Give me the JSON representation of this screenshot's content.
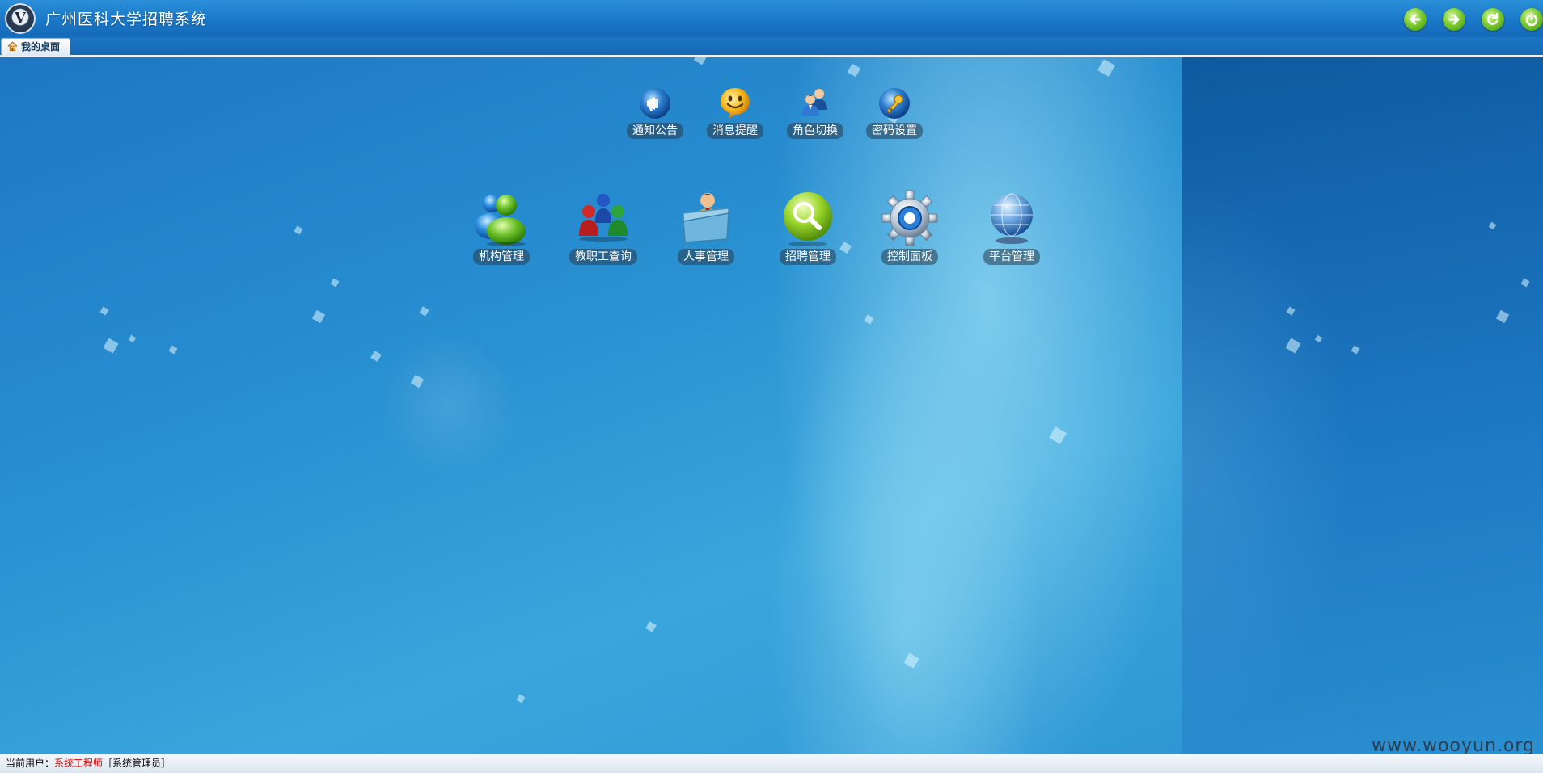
{
  "header": {
    "title": "广州医科大学招聘系统",
    "buttons": [
      {
        "name": "back-button",
        "icon": "arrow-left-icon"
      },
      {
        "name": "forward-button",
        "icon": "arrow-right-icon"
      },
      {
        "name": "refresh-button",
        "icon": "refresh-icon"
      },
      {
        "name": "power-button",
        "icon": "power-icon"
      }
    ]
  },
  "tabs": [
    {
      "label": "我的桌面",
      "icon": "home-icon",
      "active": true
    }
  ],
  "desktop": {
    "top_shortcuts": [
      {
        "label": "通知公告",
        "icon": "megaphone-icon"
      },
      {
        "label": "消息提醒",
        "icon": "smiley-icon"
      },
      {
        "label": "角色切换",
        "icon": "users-icon"
      },
      {
        "label": "密码设置",
        "icon": "key-icon"
      }
    ],
    "main_shortcuts": [
      {
        "label": "机构管理",
        "icon": "messenger-people-icon"
      },
      {
        "label": "教职工查询",
        "icon": "people-group-icon"
      },
      {
        "label": "人事管理",
        "icon": "person-folder-icon"
      },
      {
        "label": "招聘管理",
        "icon": "magnifier-icon"
      },
      {
        "label": "控制面板",
        "icon": "gear-icon"
      },
      {
        "label": "平台管理",
        "icon": "globe-icon"
      }
    ]
  },
  "status": {
    "prefix": "当前用户：",
    "user": "系统工程师",
    "role": "［系统管理员］"
  },
  "watermark": "www.wooyun.org",
  "colors": {
    "header": "#1a78c8",
    "user_name": "#e00000",
    "accent_green": "#7dcb2f"
  }
}
